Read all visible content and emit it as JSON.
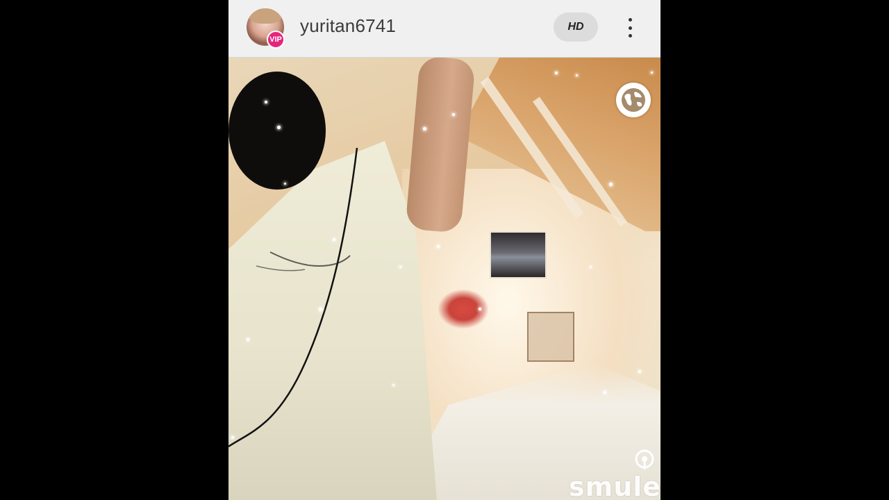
{
  "header": {
    "username": "yuritan6741",
    "avatar_icon": "user-avatar",
    "vip_badge": "VIP",
    "hd_button": "HD",
    "more_icon": "more-vertical-icon"
  },
  "video": {
    "globe_icon": "globe-icon",
    "watermark": "smule",
    "watermark_icon": "smule-mic-icon"
  },
  "colors": {
    "vip": "#e4257c",
    "topbar": "#f0f0f0",
    "background": "#000000"
  }
}
